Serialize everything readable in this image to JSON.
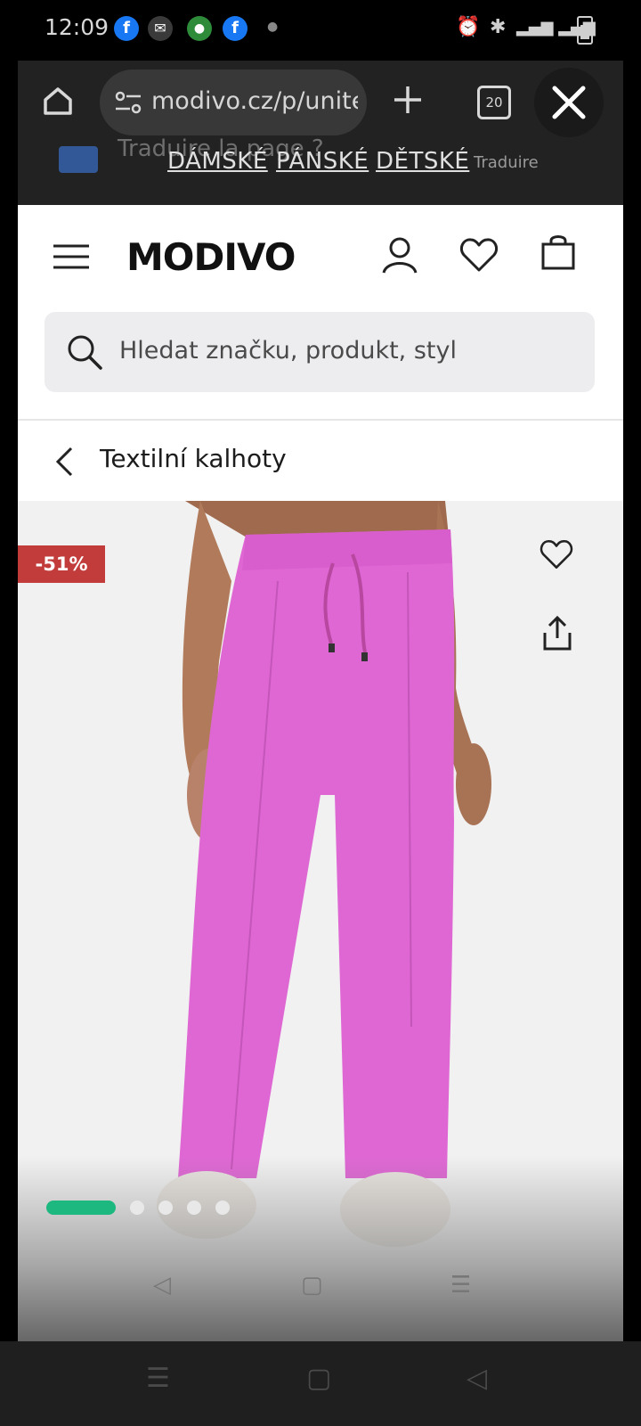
{
  "status_bar": {
    "time": "12:09",
    "left_icons": [
      "facebook-icon",
      "messenger-icon",
      "app-icon",
      "facebook-icon",
      "dot-icon"
    ],
    "right_icons": [
      "alarm-icon",
      "bluetooth-icon",
      "signal-icon",
      "battery-icon"
    ]
  },
  "browser": {
    "url": "modivo.cz/p/unite",
    "tab_count": "20",
    "translate_prompt": "Traduire la page ?",
    "nav_links": [
      "DÁMSKÉ",
      "PÁNSKÉ",
      "DĚTSKÉ"
    ],
    "nav_truncated": "Traduire"
  },
  "header": {
    "logo": "MODIVO",
    "search_placeholder": "Hledat značku, produkt, styl"
  },
  "breadcrumb": {
    "label": "Textilní kalhoty"
  },
  "product": {
    "discount": "-51%",
    "image_count": 5,
    "active_image": 1
  },
  "colors": {
    "accent": "#1db87f",
    "discount_badge": "#c33c3c",
    "pants": "#df67d4"
  }
}
